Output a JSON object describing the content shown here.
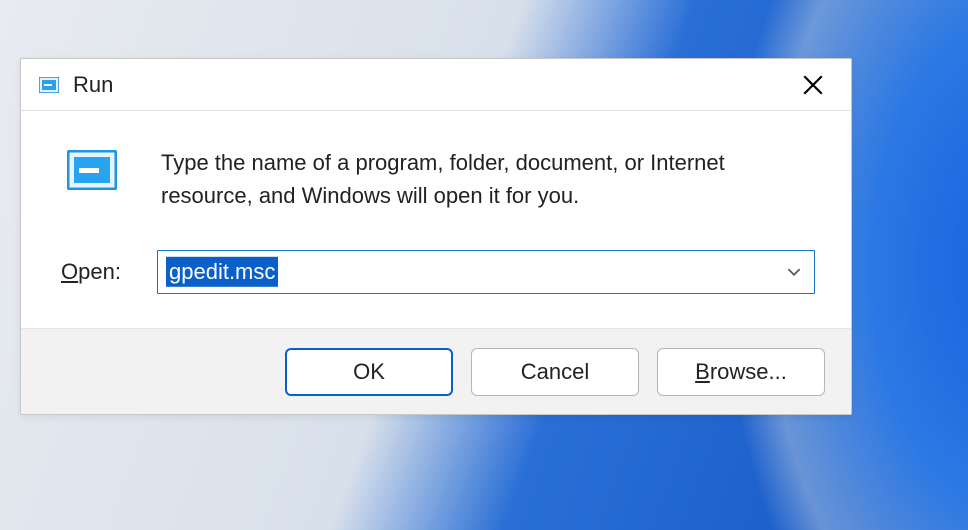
{
  "dialog": {
    "title": "Run",
    "description": "Type the name of a program, folder, document, or Internet resource, and Windows will open it for you.",
    "open_label_prefix": "O",
    "open_label_rest": "pen:",
    "input_value": "gpedit.msc",
    "buttons": {
      "ok": "OK",
      "cancel": "Cancel",
      "browse_prefix": "B",
      "browse_rest": "rowse..."
    }
  }
}
